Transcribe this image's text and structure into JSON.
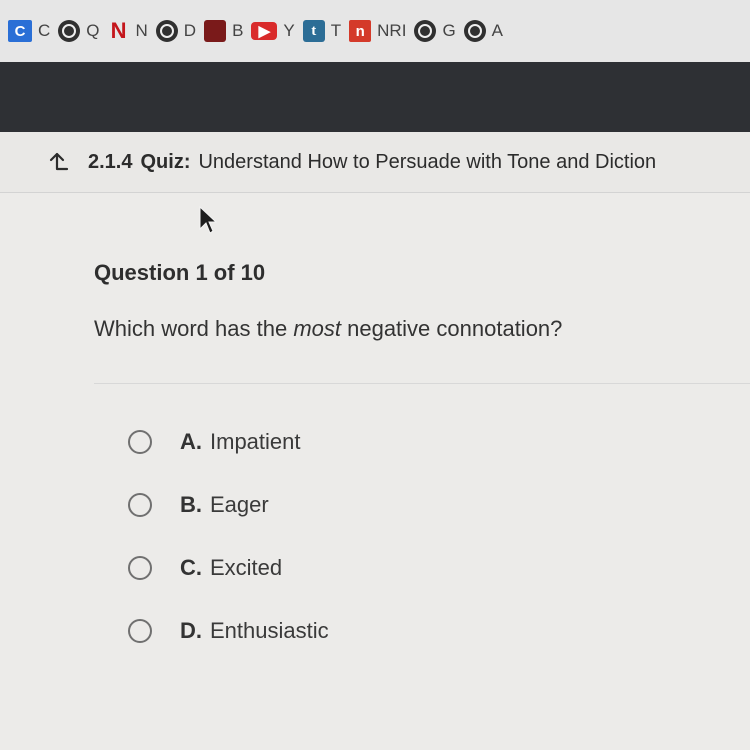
{
  "bookmarks": [
    {
      "icon": "C",
      "label": "C",
      "icon_name": "classlink-icon"
    },
    {
      "icon": "",
      "label": "Q",
      "icon_name": "globe-icon"
    },
    {
      "icon": "N",
      "label": "N",
      "icon_name": "netflix-icon"
    },
    {
      "icon": "",
      "label": "D",
      "icon_name": "globe-icon"
    },
    {
      "icon": "",
      "label": "B",
      "icon_name": "book-icon"
    },
    {
      "icon": "▶",
      "label": "Y",
      "icon_name": "youtube-icon"
    },
    {
      "icon": "t",
      "label": "T",
      "icon_name": "tumblr-icon"
    },
    {
      "icon": "n",
      "label": "NRI",
      "icon_name": "nri-icon"
    },
    {
      "icon": "",
      "label": "G",
      "icon_name": "globe-icon"
    },
    {
      "icon": "",
      "label": "A",
      "icon_name": "globe-icon"
    }
  ],
  "header": {
    "quiz_number": "2.1.4",
    "quiz_kind": "Quiz:",
    "quiz_title": "Understand How to Persuade with Tone and Diction"
  },
  "question": {
    "counter": "Question 1 of 10",
    "text_before": "Which word has the ",
    "text_emphasis": "most",
    "text_after": " negative connotation?"
  },
  "options": [
    {
      "letter": "A.",
      "text": "Impatient"
    },
    {
      "letter": "B.",
      "text": "Eager"
    },
    {
      "letter": "C.",
      "text": "Excited"
    },
    {
      "letter": "D.",
      "text": "Enthusiastic"
    }
  ],
  "colors": {
    "accent_blue": "#2a6fd6",
    "dark_band": "#2e3034",
    "text": "#2e2e2e"
  }
}
